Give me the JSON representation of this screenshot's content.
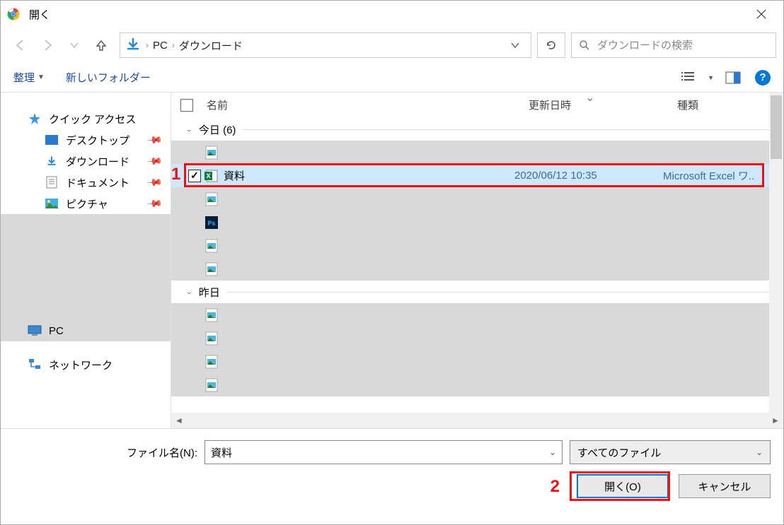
{
  "title": "開く",
  "breadcrumb": {
    "pc": "PC",
    "folder": "ダウンロード"
  },
  "search": {
    "placeholder": "ダウンロードの検索"
  },
  "toolbar": {
    "organize": "整理",
    "new_folder": "新しいフォルダー"
  },
  "sidebar": {
    "quick_access": "クイック アクセス",
    "desktop": "デスクトップ",
    "downloads": "ダウンロード",
    "documents": "ドキュメント",
    "pictures": "ピクチャ",
    "pc": "PC",
    "network": "ネットワーク"
  },
  "columns": {
    "name": "名前",
    "date": "更新日時",
    "type": "種類"
  },
  "groups": {
    "today": "今日 (6)",
    "yesterday": "昨日"
  },
  "selected_file": {
    "name": "資料",
    "date": "2020/06/12 10:35",
    "type": "Microsoft Excel ワ.."
  },
  "bottom": {
    "filename_label": "ファイル名(N):",
    "filename_value": "資料",
    "filter": "すべてのファイル",
    "open": "開く(O)",
    "cancel": "キャンセル"
  },
  "annotations": {
    "n1": "1",
    "n2": "2"
  }
}
